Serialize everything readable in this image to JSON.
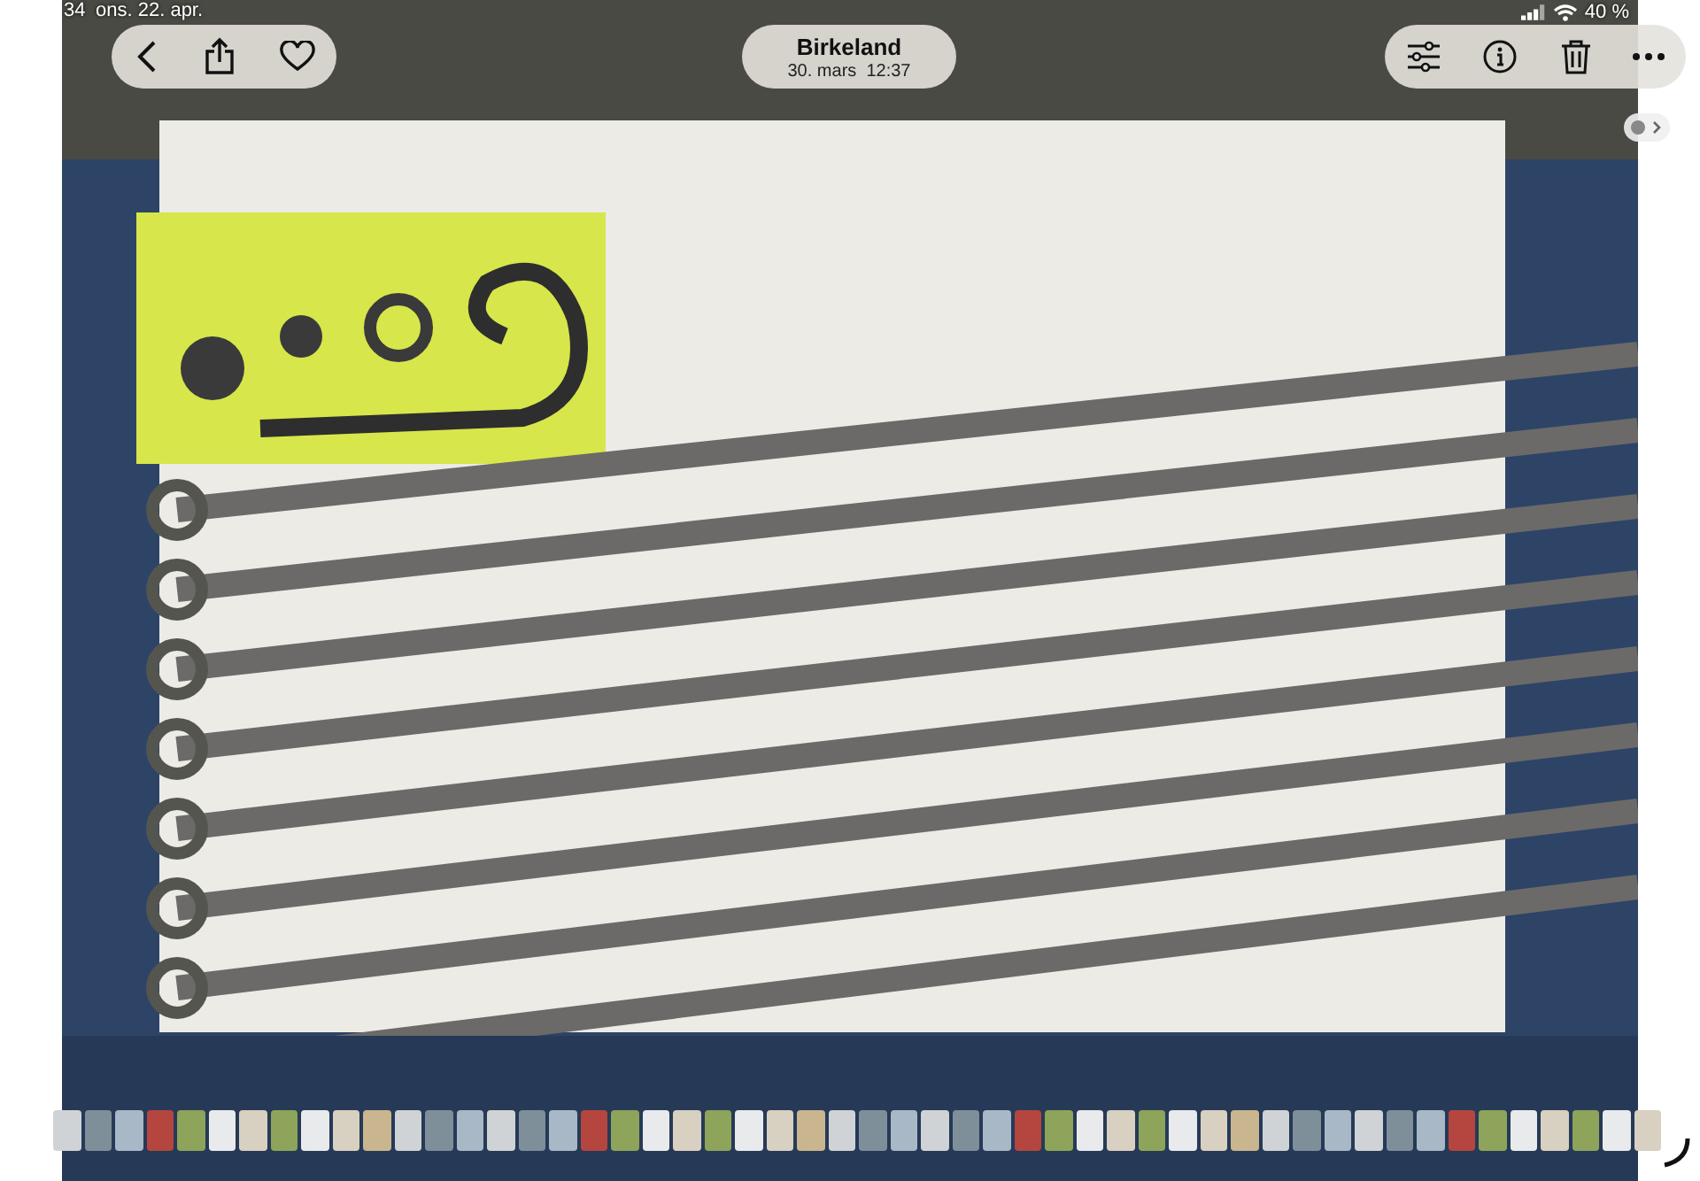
{
  "status_bar": {
    "time": "34",
    "date": "ons. 22. apr.",
    "battery": "40 %"
  },
  "header": {
    "title": "Birkeland",
    "subtitle": "30. mars  12:37"
  }
}
